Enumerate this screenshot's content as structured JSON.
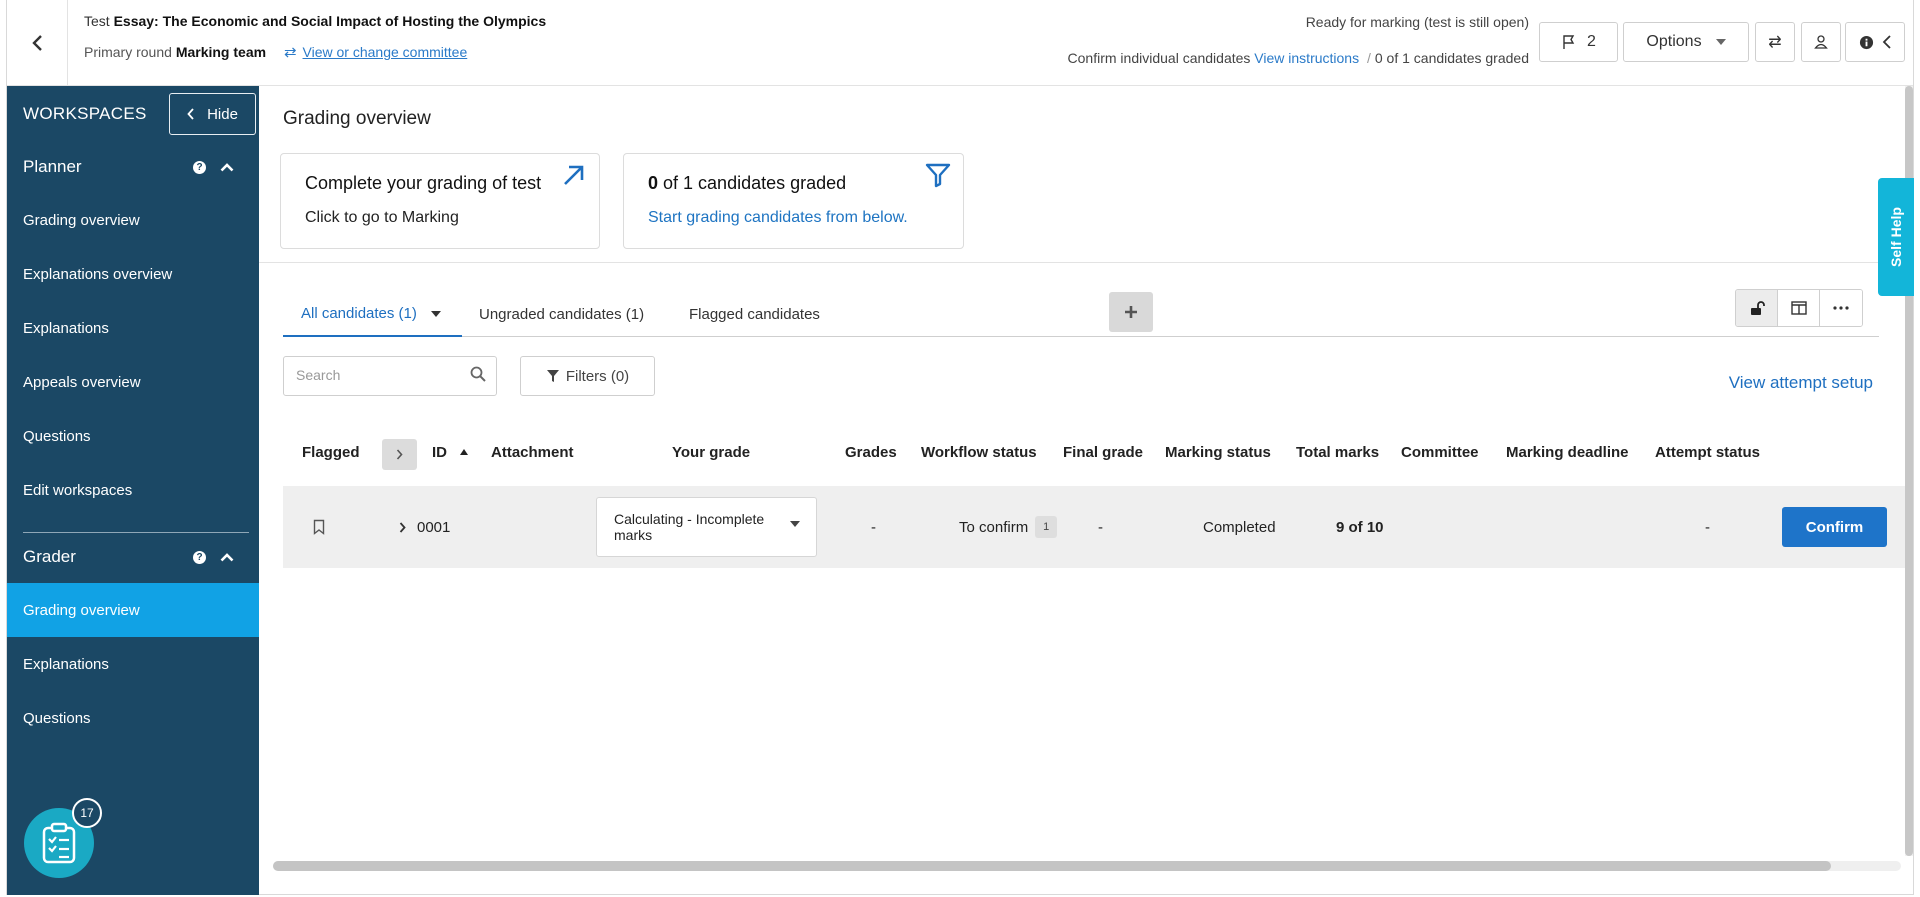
{
  "header": {
    "test_prefix": "Test",
    "test_title": "Essay: The Economic and Social Impact of Hosting the Olympics",
    "round_label": "Primary round",
    "team": "Marking team",
    "committee_link": "View or change committee",
    "status": "Ready for marking (test is still open)",
    "confirm_label": "Confirm individual candidates",
    "instructions_link": "View instructions",
    "separator": "/",
    "graded_summary": "0 of 1 candidates graded",
    "flag_count": "2",
    "options_label": "Options"
  },
  "sidebar": {
    "title": "WORKSPACES",
    "hide_label": "Hide",
    "sections": [
      {
        "title": "Planner",
        "items": [
          "Grading overview",
          "Explanations overview",
          "Explanations",
          "Appeals overview",
          "Questions",
          "Edit workspaces"
        ]
      },
      {
        "title": "Grader",
        "items": [
          "Grading overview",
          "Explanations",
          "Questions"
        ],
        "active_index": 0
      }
    ],
    "fab_badge": "17"
  },
  "main": {
    "title": "Grading overview",
    "card1": {
      "title": "Complete your grading of test",
      "subtitle": "Click to go to Marking"
    },
    "card2": {
      "count": "0",
      "title_rest": " of 1 candidates graded",
      "subtitle": "Start grading candidates from below."
    },
    "tabs": [
      "All candidates (1)",
      "Ungraded candidates (1)",
      "Flagged candidates"
    ],
    "search_placeholder": "Search",
    "filters_label": "Filters (0)",
    "attempt_setup_link": "View attempt setup",
    "columns": [
      "Flagged",
      "ID",
      "Attachment",
      "Your grade",
      "Grades",
      "Workflow status",
      "Final grade",
      "Marking status",
      "Total marks",
      "Committee",
      "Marking deadline",
      "Attempt status"
    ],
    "row": {
      "id": "0001",
      "your_grade": "Calculating - Incomplete marks",
      "grades": "-",
      "workflow_status": "To confirm",
      "workflow_count": "1",
      "final_grade": "-",
      "marking_status": "Completed",
      "total_marks": "9 of 10",
      "attempt_status": "-",
      "confirm_label": "Confirm"
    }
  },
  "self_help_label": "Self Help"
}
